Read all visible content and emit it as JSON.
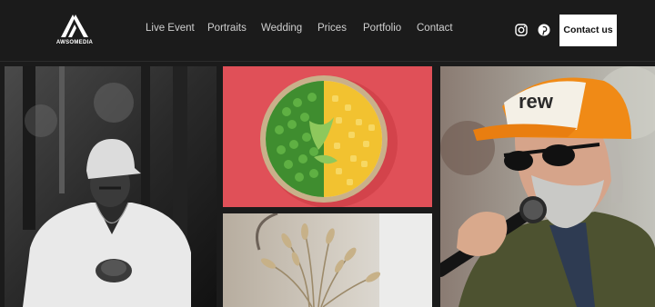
{
  "brand": {
    "name": "AWSOMEDIA"
  },
  "nav": {
    "items": [
      {
        "label": "Live Event"
      },
      {
        "label": "Portraits"
      },
      {
        "label": "Wedding"
      },
      {
        "label": "Prices"
      },
      {
        "label": "Portfolio"
      },
      {
        "label": "Contact"
      }
    ]
  },
  "social": {
    "icons": [
      "instagram-icon",
      "pinterest-icon"
    ]
  },
  "cta": {
    "label": "Contact us"
  },
  "gallery": {
    "photos": [
      {
        "name": "bw-portrait-man-cap"
      },
      {
        "name": "peas-corn-bowl"
      },
      {
        "name": "singer-with-microphone"
      },
      {
        "name": "dried-grass-vase"
      }
    ]
  },
  "colors": {
    "background": "#1b1b1b",
    "nav_text": "#cfcfcf",
    "button_bg": "#ffffff",
    "button_text": "#111111"
  }
}
